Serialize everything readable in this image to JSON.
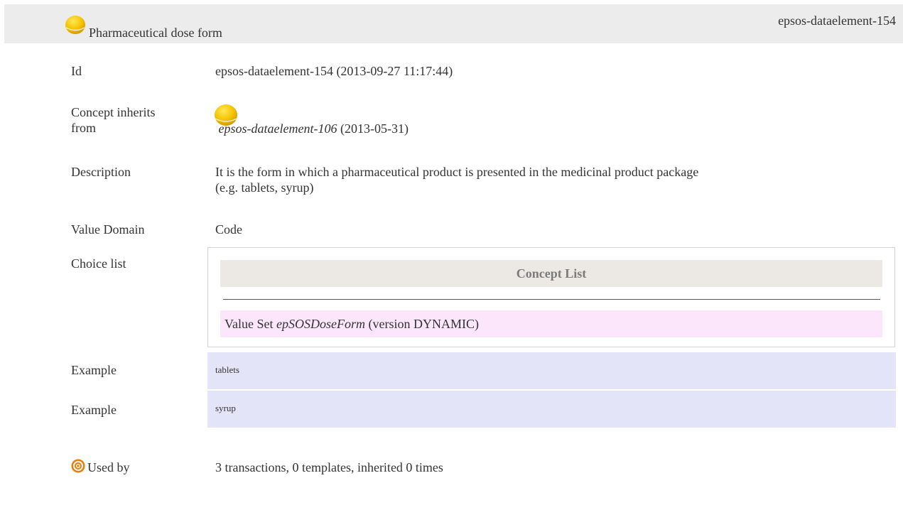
{
  "header": {
    "title": "Pharmaceutical dose form",
    "element_id": "epsos-dataelement-154",
    "status_icon": "yellow-ball-icon"
  },
  "rows": {
    "id": {
      "label": "Id",
      "value": "epsos-dataelement-154 (2013-09-27 11:17:44)"
    },
    "inherits": {
      "label_line1": "Concept inherits",
      "label_line2": "from",
      "link": "epsos-dataelement-106",
      "date": "(2013-05-31)",
      "icon": "yellow-ball-icon"
    },
    "description": {
      "label": "Description",
      "line1": "It is the form in which a pharmaceutical product is presented in the medicinal product package",
      "line2": "(e.g. tablets, syrup)"
    },
    "value_domain": {
      "label": "Value Domain",
      "value": "Code"
    },
    "choice_list": {
      "label": "Choice list",
      "header": "Concept List",
      "valueset_prefix": "Value Set",
      "valueset_name": "epSOSDoseForm",
      "valueset_suffix": "(version DYNAMIC)"
    },
    "examples": [
      {
        "label": "Example",
        "value": "tablets"
      },
      {
        "label": "Example",
        "value": "syrup"
      }
    ],
    "used_by": {
      "label": "Used by",
      "value": "3 transactions, 0 templates, inherited 0 times",
      "icon": "target-icon"
    }
  },
  "colors": {
    "header_bg": "#ececec",
    "concept_header_bg": "#ece9e4",
    "valueset_bg": "#fce6fc",
    "example_bg": "#e4e4f8",
    "ball": "#f5c400"
  }
}
